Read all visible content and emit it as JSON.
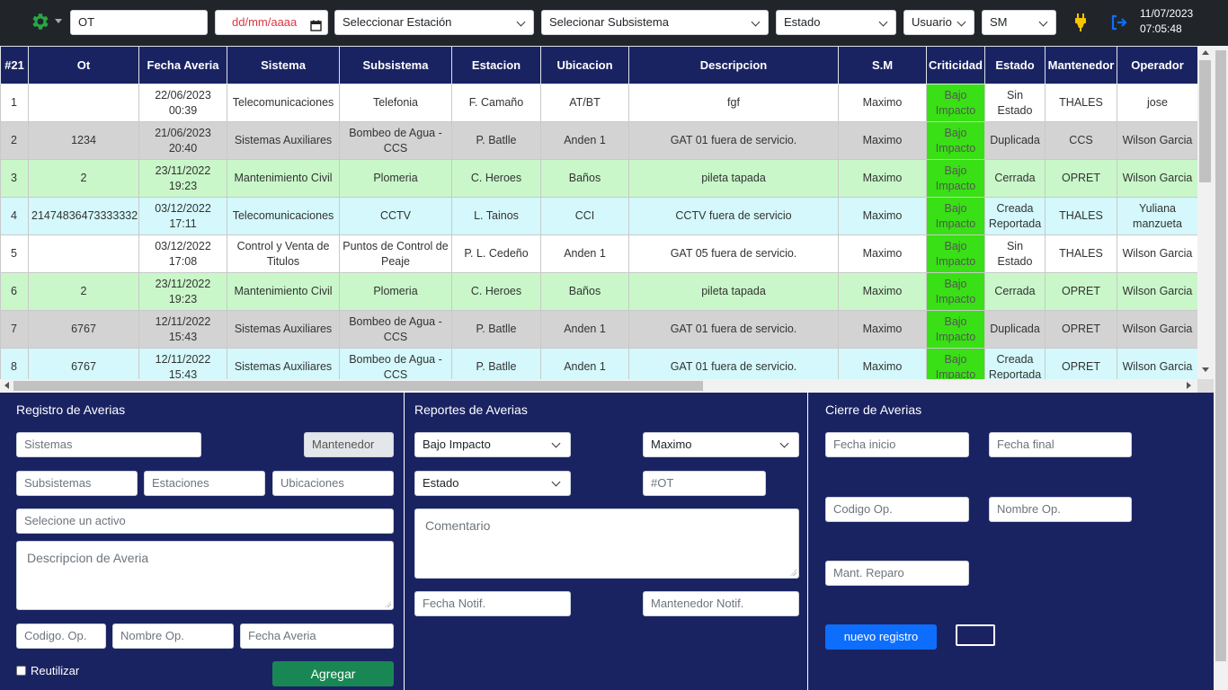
{
  "toolbar": {
    "ot_input": "OT",
    "date_placeholder": "dd/mm/aaaa",
    "station_select": "Seleccionar Estación",
    "subsystem_select": "Selecionar Subsistema",
    "state_select": "Estado",
    "user_select": "Usuario",
    "sm_select": "SM",
    "clock_date": "11/07/2023",
    "clock_time": "07:05:48",
    "icons": {
      "settings": "gear-icon",
      "calendar": "calendar-icon",
      "plug": "plug-icon",
      "logout": "logout-icon"
    },
    "accent_gear": "#28a745",
    "accent_plug": "#f7c500",
    "accent_logout": "#0d6efd"
  },
  "table": {
    "headers": [
      "#21",
      "Ot",
      "Fecha Averia",
      "Sistema",
      "Subsistema",
      "Estacion",
      "Ubicacion",
      "Descripcion",
      "S.M",
      "Criticidad",
      "Estado",
      "Mantenedor",
      "Operador"
    ],
    "rows": [
      {
        "style": "white",
        "cells": [
          "1",
          "",
          "22/06/2023 00:39",
          "Telecomunicaciones",
          "Telefonia",
          "F. Camaño",
          "AT/BT",
          "fgf",
          "Maximo",
          "Bajo Impacto",
          "Sin Estado",
          "THALES",
          "jose"
        ]
      },
      {
        "style": "gray",
        "cells": [
          "2",
          "1234",
          "21/06/2023 20:40",
          "Sistemas Auxiliares",
          "Bombeo de Agua - CCS",
          "P. Batlle",
          "Anden 1",
          "GAT 01 fuera de servicio.",
          "Maximo",
          "Bajo Impacto",
          "Duplicada",
          "CCS",
          "Wilson Garcia"
        ]
      },
      {
        "style": "green",
        "cells": [
          "3",
          "2",
          "23/11/2022 19:23",
          "Mantenimiento Civil",
          "Plomeria",
          "C. Heroes",
          "Baños",
          "pileta tapada",
          "Maximo",
          "Bajo Impacto",
          "Cerrada",
          "OPRET",
          "Wilson Garcia"
        ]
      },
      {
        "style": "cyan",
        "cells": [
          "4",
          "21474836473333332",
          "03/12/2022 17:11",
          "Telecomunicaciones",
          "CCTV",
          "L. Tainos",
          "CCI",
          "CCTV fuera de servicio",
          "Maximo",
          "Bajo Impacto",
          "Creada Reportada",
          "THALES",
          "Yuliana manzueta"
        ]
      },
      {
        "style": "white",
        "cells": [
          "5",
          "",
          "03/12/2022 17:08",
          "Control y Venta de Titulos",
          "Puntos de Control de Peaje",
          "P. L. Cedeño",
          "Anden 1",
          "GAT 05 fuera de servicio.",
          "Maximo",
          "Bajo Impacto",
          "Sin Estado",
          "THALES",
          "Wilson Garcia"
        ]
      },
      {
        "style": "green",
        "cells": [
          "6",
          "2",
          "23/11/2022 19:23",
          "Mantenimiento Civil",
          "Plomeria",
          "C. Heroes",
          "Baños",
          "pileta tapada",
          "Maximo",
          "Bajo Impacto",
          "Cerrada",
          "OPRET",
          "Wilson Garcia"
        ]
      },
      {
        "style": "gray",
        "cells": [
          "7",
          "6767",
          "12/11/2022 15:43",
          "Sistemas Auxiliares",
          "Bombeo de Agua - CCS",
          "P. Batlle",
          "Anden 1",
          "GAT 01 fuera de servicio.",
          "Maximo",
          "Bajo Impacto",
          "Duplicada",
          "OPRET",
          "Wilson Garcia"
        ]
      },
      {
        "style": "cyan",
        "cells": [
          "8",
          "6767",
          "12/11/2022 15:43",
          "Sistemas Auxiliares",
          "Bombeo de Agua - CCS",
          "P. Batlle",
          "Anden 1",
          "GAT 01 fuera de servicio.",
          "Maximo",
          "Bajo Impacto",
          "Creada Reportada",
          "OPRET",
          "Wilson Garcia"
        ]
      }
    ]
  },
  "registro": {
    "title": "Registro de Averias",
    "sistemas": "Sistemas",
    "mantenedor": "Mantenedor",
    "subsistemas": "Subsistemas",
    "estaciones": "Estaciones",
    "ubicaciones": "Ubicaciones",
    "activo": "Selecione un activo",
    "descripcion": "Descripcion de Averia",
    "codigo_op": "Codigo. Op.",
    "nombre_op": "Nombre Op.",
    "fecha_averia": "Fecha Averia",
    "reutilizar": "Reutilizar",
    "agregar": "Agregar"
  },
  "reportes": {
    "title": "Reportes de Averias",
    "criticidad": "Bajo Impacto",
    "sm": "Maximo",
    "estado": "Estado",
    "ot": "#OT",
    "comentario": "Comentario",
    "fecha_notif": "Fecha Notif.",
    "mantenedor_notif": "Mantenedor Notif."
  },
  "cierre": {
    "title": "Cierre de Averias",
    "fecha_inicio": "Fecha inicio",
    "fecha_final": "Fecha final",
    "codigo_op": "Codigo Op.",
    "nombre_op": "Nombre Op.",
    "mant_reparo": "Mant. Reparo",
    "nuevo_registro": "nuevo registro"
  },
  "colors": {
    "header_bg": "#1a2362",
    "criticidad_bajo": "#39e015",
    "agregar_btn": "#198754",
    "nuevo_btn": "#0d6efd"
  }
}
